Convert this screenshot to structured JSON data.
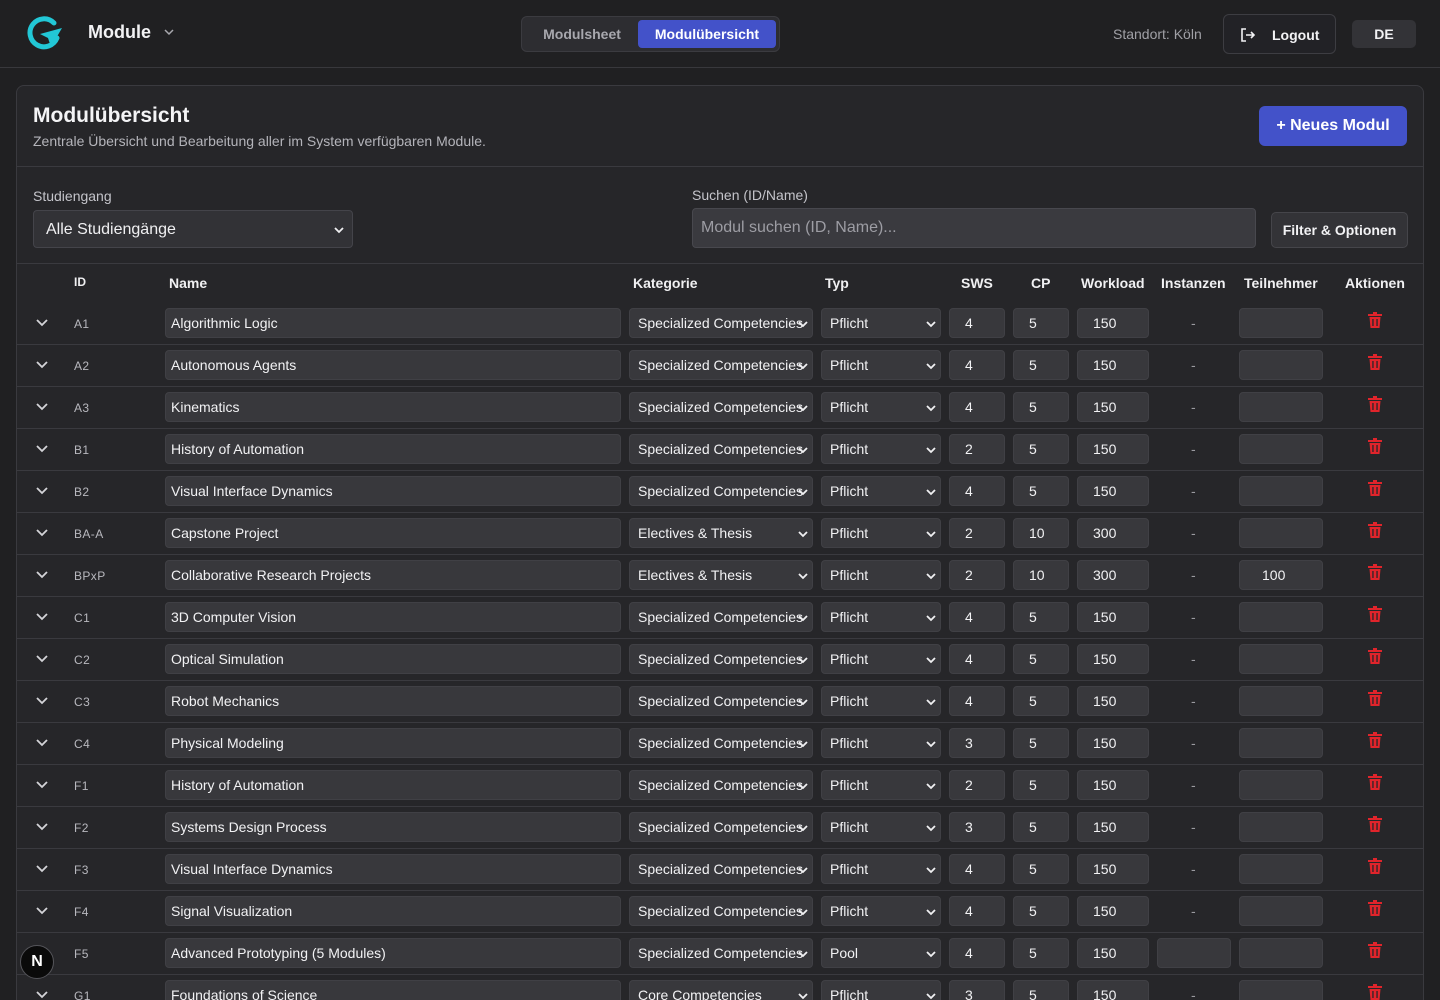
{
  "header": {
    "module_title": "Module",
    "view_toggle": [
      "Modulsheet",
      "Modulübersicht"
    ],
    "active_view": "Modulübersicht",
    "location": "Standort: Köln",
    "logout_label": "Logout",
    "language": "DE"
  },
  "page": {
    "title": "Modulübersicht",
    "subtitle": "Zentrale Übersicht und Bearbeitung aller im System verfügbaren Module.",
    "new_button": "+ Neues Modul"
  },
  "filters": {
    "studiengang_label": "Studiengang",
    "studiengang_value": "Alle Studiengänge",
    "search_label": "Suchen (ID/Name)",
    "search_placeholder": "Modul suchen (ID, Name)...",
    "filter_button": "Filter & Optionen"
  },
  "table": {
    "columns": [
      "ID",
      "Name",
      "Kategorie",
      "Typ",
      "SWS",
      "CP",
      "Workload",
      "Instanzen",
      "Teilnehmer",
      "Aktionen"
    ],
    "rows": [
      {
        "id": "A1",
        "name": "Algorithmic Logic",
        "kategorie": "Specialized Competencies",
        "typ": "Pflicht",
        "sws": "4",
        "cp": "5",
        "workload": "150",
        "instanzen": "-",
        "teilnehmer": ""
      },
      {
        "id": "A2",
        "name": "Autonomous Agents",
        "kategorie": "Specialized Competencies",
        "typ": "Pflicht",
        "sws": "4",
        "cp": "5",
        "workload": "150",
        "instanzen": "-",
        "teilnehmer": ""
      },
      {
        "id": "A3",
        "name": "Kinematics",
        "kategorie": "Specialized Competencies",
        "typ": "Pflicht",
        "sws": "4",
        "cp": "5",
        "workload": "150",
        "instanzen": "-",
        "teilnehmer": ""
      },
      {
        "id": "B1",
        "name": "History of Automation",
        "kategorie": "Specialized Competencies",
        "typ": "Pflicht",
        "sws": "2",
        "cp": "5",
        "workload": "150",
        "instanzen": "-",
        "teilnehmer": ""
      },
      {
        "id": "B2",
        "name": "Visual Interface Dynamics",
        "kategorie": "Specialized Competencies",
        "typ": "Pflicht",
        "sws": "4",
        "cp": "5",
        "workload": "150",
        "instanzen": "-",
        "teilnehmer": ""
      },
      {
        "id": "BA-A",
        "name": "Capstone Project",
        "kategorie": "Electives & Thesis",
        "typ": "Pflicht",
        "sws": "2",
        "cp": "10",
        "workload": "300",
        "instanzen": "-",
        "teilnehmer": ""
      },
      {
        "id": "BPxP",
        "name": "Collaborative Research Projects",
        "kategorie": "Electives & Thesis",
        "typ": "Pflicht",
        "sws": "2",
        "cp": "10",
        "workload": "300",
        "instanzen": "-",
        "teilnehmer": "100"
      },
      {
        "id": "C1",
        "name": "3D Computer Vision",
        "kategorie": "Specialized Competencies",
        "typ": "Pflicht",
        "sws": "4",
        "cp": "5",
        "workload": "150",
        "instanzen": "-",
        "teilnehmer": ""
      },
      {
        "id": "C2",
        "name": "Optical Simulation",
        "kategorie": "Specialized Competencies",
        "typ": "Pflicht",
        "sws": "4",
        "cp": "5",
        "workload": "150",
        "instanzen": "-",
        "teilnehmer": ""
      },
      {
        "id": "C3",
        "name": "Robot Mechanics",
        "kategorie": "Specialized Competencies",
        "typ": "Pflicht",
        "sws": "4",
        "cp": "5",
        "workload": "150",
        "instanzen": "-",
        "teilnehmer": ""
      },
      {
        "id": "C4",
        "name": "Physical Modeling",
        "kategorie": "Specialized Competencies",
        "typ": "Pflicht",
        "sws": "3",
        "cp": "5",
        "workload": "150",
        "instanzen": "-",
        "teilnehmer": ""
      },
      {
        "id": "F1",
        "name": "History of Automation",
        "kategorie": "Specialized Competencies",
        "typ": "Pflicht",
        "sws": "2",
        "cp": "5",
        "workload": "150",
        "instanzen": "-",
        "teilnehmer": ""
      },
      {
        "id": "F2",
        "name": "Systems Design Process",
        "kategorie": "Specialized Competencies",
        "typ": "Pflicht",
        "sws": "3",
        "cp": "5",
        "workload": "150",
        "instanzen": "-",
        "teilnehmer": ""
      },
      {
        "id": "F3",
        "name": "Visual Interface Dynamics",
        "kategorie": "Specialized Competencies",
        "typ": "Pflicht",
        "sws": "4",
        "cp": "5",
        "workload": "150",
        "instanzen": "-",
        "teilnehmer": ""
      },
      {
        "id": "F4",
        "name": "Signal Visualization",
        "kategorie": "Specialized Competencies",
        "typ": "Pflicht",
        "sws": "4",
        "cp": "5",
        "workload": "150",
        "instanzen": "-",
        "teilnehmer": ""
      },
      {
        "id": "F5",
        "name": "Advanced Prototyping (5 Modules)",
        "kategorie": "Specialized Competencies",
        "typ": "Pool",
        "sws": "4",
        "cp": "5",
        "workload": "150",
        "instanzen": "",
        "teilnehmer": ""
      },
      {
        "id": "G1",
        "name": "Foundations of Science",
        "kategorie": "Core Competencies",
        "typ": "Pflicht",
        "sws": "3",
        "cp": "5",
        "workload": "150",
        "instanzen": "-",
        "teilnehmer": ""
      }
    ]
  },
  "badge": "N",
  "colors": {
    "accent": "#4352c9",
    "logo": "#22c7d6",
    "delete": "#e0242b",
    "background": "#202022"
  },
  "icons": [
    "logo-icon",
    "chevron-down-icon",
    "logout-icon",
    "expand-chevron-icon",
    "trash-icon"
  ]
}
